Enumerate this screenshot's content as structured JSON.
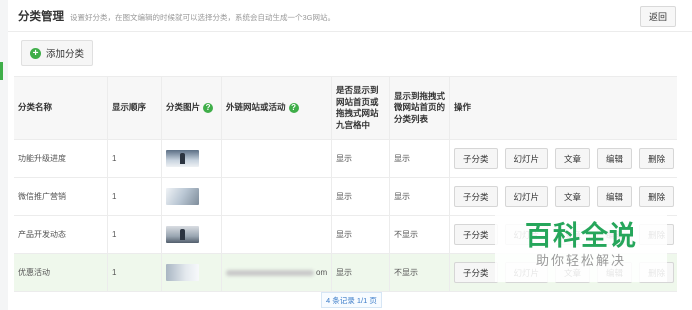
{
  "header": {
    "title": "分类管理",
    "subtitle": "设置好分类，在图文编辑的时候就可以选择分类，系统会自动生成一个3G网站。",
    "back_label": "返回"
  },
  "toolbar": {
    "add_label": "添加分类"
  },
  "table": {
    "columns": [
      "分类名称",
      "显示顺序",
      "分类图片",
      "外链网站或活动",
      "是否显示到网站首页或拖拽式网站九宫格中",
      "显示到拖拽式微网站首页的分类列表",
      "操作"
    ],
    "rows": [
      {
        "name": "功能升级进度",
        "order": "1",
        "link": "",
        "show_home": "显示",
        "show_list": "显示"
      },
      {
        "name": "微信推广营销",
        "order": "1",
        "link": "",
        "show_home": "显示",
        "show_list": "显示"
      },
      {
        "name": "产品开发动态",
        "order": "1",
        "link": "",
        "show_home": "显示",
        "show_list": "不显示"
      },
      {
        "name": "优惠活动",
        "order": "1",
        "link": "om",
        "show_home": "显示",
        "show_list": "不显示"
      }
    ],
    "actions": [
      "子分类",
      "幻灯片",
      "文章",
      "编辑",
      "删除"
    ]
  },
  "pagination": {
    "text": "4 条记录 1/1 页"
  },
  "watermark": {
    "main": "百科全说",
    "sub": "助你轻松解决"
  },
  "colors": {
    "accent": "#3fae49",
    "highlight_row": "#eff8ec",
    "watermark": "#26a65b"
  }
}
